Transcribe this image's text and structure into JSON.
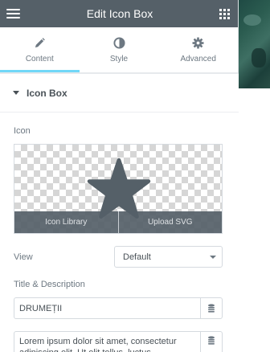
{
  "header": {
    "title": "Edit Icon Box"
  },
  "tabs": [
    {
      "label": "Content",
      "icon": "pencil-icon",
      "active": true
    },
    {
      "label": "Style",
      "icon": "contrast-icon",
      "active": false
    },
    {
      "label": "Advanced",
      "icon": "gear-icon",
      "active": false
    }
  ],
  "section": {
    "title": "Icon Box"
  },
  "icon_field": {
    "label": "Icon",
    "selected_icon": "star-icon",
    "library_label": "Icon Library",
    "upload_label": "Upload SVG"
  },
  "view_field": {
    "label": "View",
    "value": "Default"
  },
  "title_desc": {
    "label": "Title & Description",
    "title_value": "DRUMEȚII",
    "description_value": "Lorem ipsum dolor sit amet, consectetur adipiscing elit. Ut elit tellus, luctus"
  },
  "colors": {
    "header_bg": "#556068",
    "accent": "#71d7f7",
    "text": "#6d7882"
  }
}
